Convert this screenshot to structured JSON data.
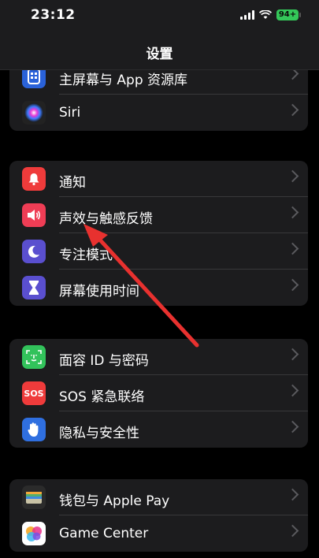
{
  "status_bar": {
    "time": "23:12",
    "battery": "94+"
  },
  "nav": {
    "title": "设置"
  },
  "groups": [
    {
      "items": [
        {
          "label": "主屏幕与 App 资源库",
          "icon": "home-screen-icon",
          "color": "#2a62d9"
        },
        {
          "label": "Siri",
          "icon": "siri-icon",
          "color": "#222222"
        }
      ]
    },
    {
      "items": [
        {
          "label": "通知",
          "icon": "notifications-icon",
          "color": "#ef3b3b"
        },
        {
          "label": "声效与触感反馈",
          "icon": "sounds-icon",
          "color": "#ef3d55"
        },
        {
          "label": "专注模式",
          "icon": "focus-icon",
          "color": "#5a4fcf"
        },
        {
          "label": "屏幕使用时间",
          "icon": "screen-time-icon",
          "color": "#5a4fcf"
        }
      ]
    },
    {
      "items": [
        {
          "label": "面容 ID 与密码",
          "icon": "face-id-icon",
          "color": "#32c25b"
        },
        {
          "label": "SOS 紧急联络",
          "icon": "sos-icon",
          "color": "#ef3b3b",
          "icon_text": "SOS"
        },
        {
          "label": "隐私与安全性",
          "icon": "privacy-hand-icon",
          "color": "#2f6fe0"
        }
      ]
    },
    {
      "items": [
        {
          "label": "钱包与 Apple Pay",
          "icon": "wallet-icon",
          "color": "#2b2b2b"
        },
        {
          "label": "Game Center",
          "icon": "game-center-icon",
          "color": "#ffffff"
        }
      ]
    }
  ],
  "annotation": {
    "arrow_color": "#e8312f"
  }
}
